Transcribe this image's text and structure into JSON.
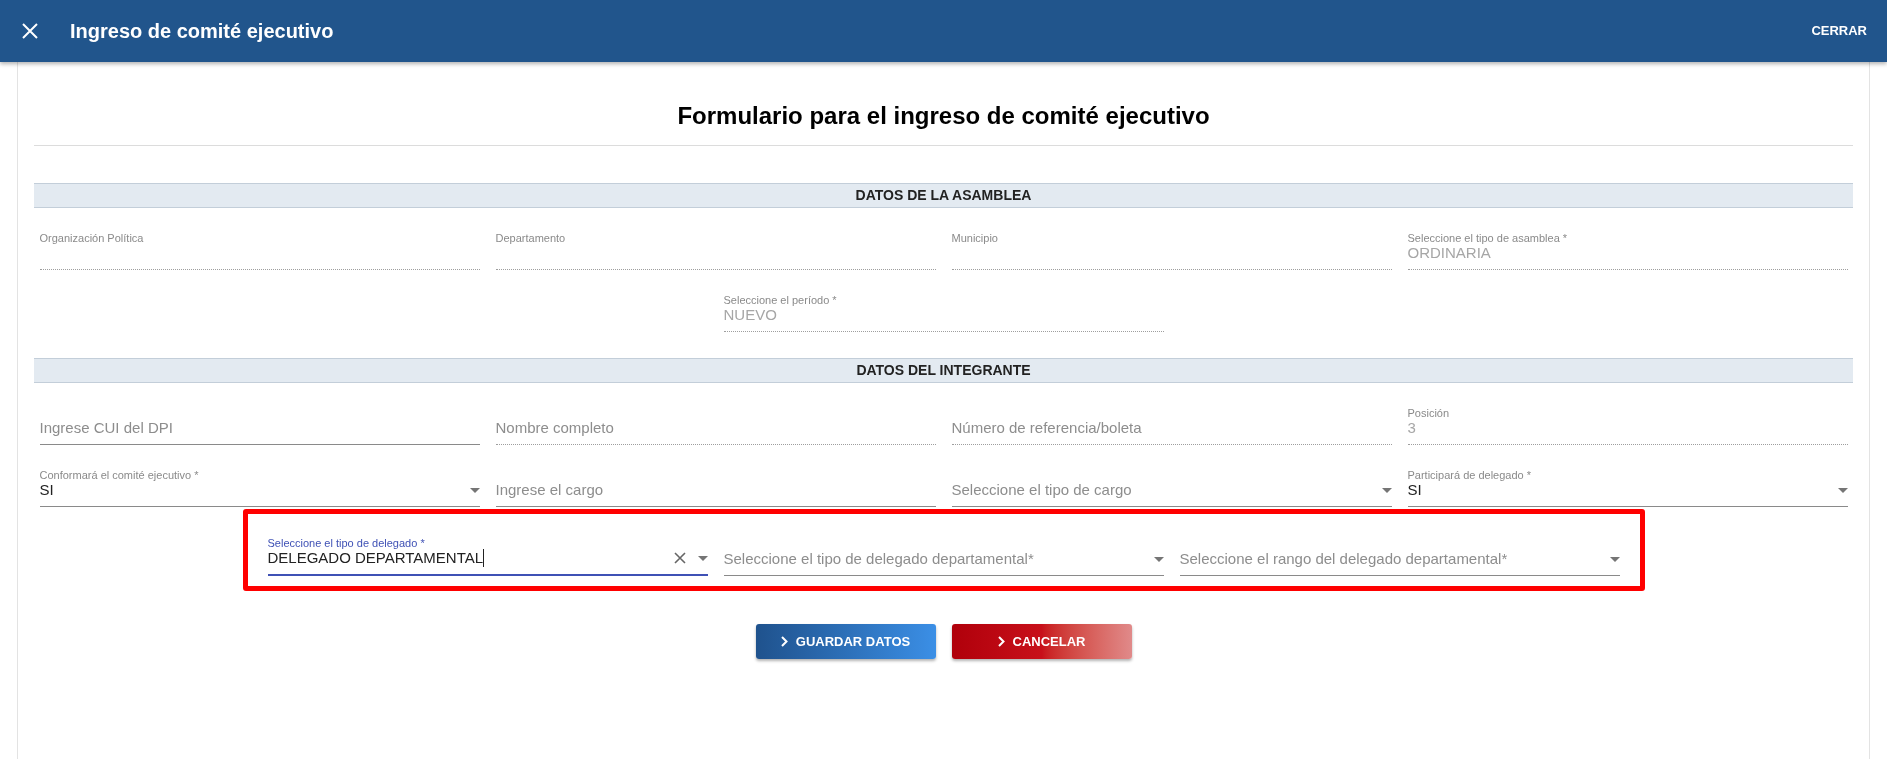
{
  "header": {
    "title": "Ingreso de comité ejecutivo",
    "close_label": "CERRAR"
  },
  "form": {
    "title": "Formulario para el ingreso de comité ejecutivo",
    "sections": [
      {
        "heading": "DATOS DE LA ASAMBLEA",
        "rows": [
          {
            "highlighted": false,
            "fields": [
              {
                "kind": "text",
                "label": "Organización Política",
                "disabled": true,
                "focused": false
              },
              {
                "kind": "text",
                "label": "Departamento",
                "disabled": true,
                "focused": false
              },
              {
                "kind": "text",
                "label": "Municipio",
                "disabled": true,
                "focused": false
              },
              {
                "kind": "text",
                "label": "Seleccione el tipo de asamblea *",
                "value": "ORDINARIA",
                "disabled": true,
                "focused": false
              }
            ]
          },
          {
            "highlighted": false,
            "fields": [
              {
                "kind": "text",
                "label": "Seleccione el período *",
                "value": "NUEVO",
                "disabled": true,
                "focused": false
              }
            ]
          }
        ]
      },
      {
        "heading": "DATOS DEL INTEGRANTE",
        "rows": [
          {
            "highlighted": false,
            "fields": [
              {
                "kind": "text",
                "placeholder": "Ingrese CUI del DPI",
                "disabled": false,
                "focused": false
              },
              {
                "kind": "text",
                "placeholder": "Nombre completo",
                "disabled": true,
                "focused": false
              },
              {
                "kind": "text",
                "placeholder": "Número de referencia/boleta",
                "disabled": true,
                "focused": false
              },
              {
                "kind": "text",
                "label": "Posición",
                "value": "3",
                "disabled": true,
                "focused": false
              }
            ]
          },
          {
            "highlighted": false,
            "fields": [
              {
                "kind": "select",
                "label": "Conformará el comité ejecutivo *",
                "value": "SI",
                "disabled": false,
                "focused": false
              },
              {
                "kind": "text",
                "placeholder": "Ingrese el cargo",
                "disabled": false,
                "focused": false
              },
              {
                "kind": "select",
                "placeholder": "Seleccione el tipo de cargo",
                "disabled": false,
                "focused": false
              },
              {
                "kind": "select",
                "label": "Participará de delegado *",
                "value": "SI",
                "disabled": false,
                "focused": false
              }
            ]
          },
          {
            "highlighted": true,
            "fields": [
              {
                "kind": "select",
                "label": "Seleccione el tipo de delegado *",
                "value": "DELEGADO DEPARTAMENTAL",
                "disabled": false,
                "focused": true
              },
              {
                "kind": "select",
                "placeholder": "Seleccione el tipo de delegado departamental*",
                "disabled": false,
                "focused": false
              },
              {
                "kind": "select",
                "placeholder": "Seleccione el rango del delegado departamental*",
                "disabled": false,
                "focused": false
              }
            ]
          }
        ]
      }
    ]
  },
  "buttons": [
    {
      "label": "GUARDAR DATOS",
      "kind": "primary"
    },
    {
      "label": "CANCELAR",
      "kind": "danger"
    }
  ]
}
